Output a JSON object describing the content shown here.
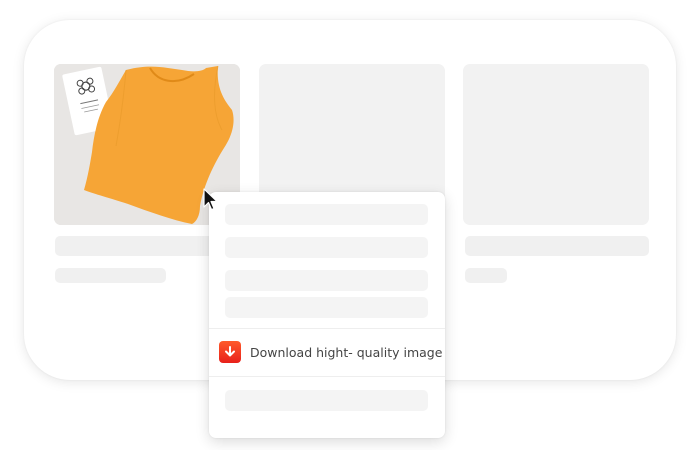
{
  "context_menu": {
    "download_item": {
      "label": "Download hight- quality image",
      "icon": "download-arrow-icon",
      "icon_color": "#f03a1f"
    }
  },
  "product_image": {
    "subject": "orange sleeveless tank top",
    "shirt_color": "#f6a536"
  },
  "colors": {
    "placeholder": "#f2f2f2",
    "background": "#ffffff"
  }
}
